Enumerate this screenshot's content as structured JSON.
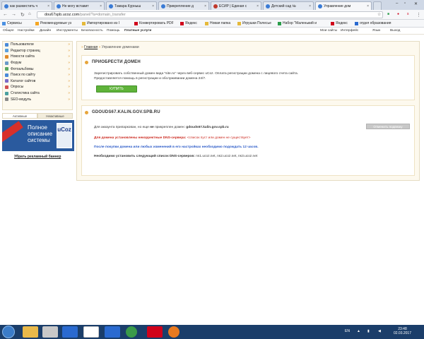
{
  "tabs": [
    {
      "label": "как разместить ч",
      "color": "#3a7bd5"
    },
    {
      "label": "Не могу вставит",
      "color": "#3a7bd5"
    },
    {
      "label": "Тамара Курныш",
      "color": "#3a7bd5"
    },
    {
      "label": "Прикрепление д",
      "color": "#3a7bd5"
    },
    {
      "label": "ЕСИР | Единая с",
      "color": "#c0392b"
    },
    {
      "label": "Детский сад №",
      "color": "#3a7bd5"
    },
    {
      "label": "Управление дом",
      "color": "#3a7bd5"
    }
  ],
  "address": {
    "host": "dou67spb.ucoz.com",
    "path": "/panel/?a=domain_transfer"
  },
  "bookmarks": [
    {
      "label": "Сервисы",
      "color": "#4a90e2"
    },
    {
      "label": "Рекомендуемые уз",
      "color": "#f5a623"
    },
    {
      "label": "Импортировано из I",
      "color": "#e5b93a"
    },
    {
      "label": "Конвертировать PDF",
      "color": "#d0021b"
    },
    {
      "label": "Яндекс",
      "color": "#d0021b"
    },
    {
      "label": "Новая папка",
      "color": "#e5b93a"
    },
    {
      "label": "Игрушки Полесье",
      "color": "#e5b93a"
    },
    {
      "label": "Набор \"Маленький и",
      "color": "#2a9d4a"
    },
    {
      "label": "Яндекс",
      "color": "#d0021b"
    },
    {
      "label": "отдел образования",
      "color": "#2a6ad0"
    }
  ],
  "ucoz_menu": {
    "left": [
      "Общее",
      "Настройки",
      "Дизайн",
      "Инструменты",
      "Безопасность",
      "Помощь",
      "Платные услуги"
    ],
    "right": [
      "Мои сайты",
      "Интерфейс",
      "Язык",
      "Выход"
    ]
  },
  "sidebar": {
    "items": [
      {
        "label": "Пользователи",
        "color": "#4a8ad8"
      },
      {
        "label": "Редактор страниц",
        "color": "#5aa0e0"
      },
      {
        "label": "Новости сайта",
        "color": "#e08a2a"
      },
      {
        "label": "Форум",
        "color": "#6a9ac8"
      },
      {
        "label": "Фотоальбомы",
        "color": "#5aa860"
      },
      {
        "label": "Поиск по сайту",
        "color": "#4a8ad8"
      },
      {
        "label": "Каталог сайтов",
        "color": "#7a6ac8"
      },
      {
        "label": "Опросы",
        "color": "#d05050"
      },
      {
        "label": "Статистика сайта",
        "color": "#4aa0a0"
      },
      {
        "label": "SEO-модуль",
        "color": "#8a8a8a"
      }
    ],
    "tabs": [
      "Активные",
      "Неактивные"
    ]
  },
  "banner": {
    "line1": "Полное",
    "line2": "описание",
    "line3": "системы",
    "logo": "uCoz",
    "remove_label": "Убрать рекламный баннер"
  },
  "breadcrumb": {
    "home": "Главная",
    "current": "Управление доменами"
  },
  "buy_card": {
    "title": "ПРИОБРЕСТИ ДОМЕН",
    "line1": "Зарегистрировать собственный домен вида \"site.ru\" через веб-сервис uCoz. Оплата регистрации домена с лицевого счета сайта.",
    "line2": "Предоставляется помощь в регистрации и обслуживании домена 24/7.",
    "button": "КУПИТЬ"
  },
  "domain_card": {
    "title": "GDOUDS67.KALIN.GOV.SPB.RU",
    "line1_a": "Для аккаунта припаркован, но еще",
    "line1_b": "не",
    "line1_c": "прикреплен домен:",
    "domain": "gdouds67.kalin.gov.spb.ru",
    "unbind_button": "Отменить подвязку",
    "warn_a": "Для домена установлены некорректные DNS-сервера:",
    "warn_b": "<список пуст или домен не существует>",
    "wait": "После покупки домена или любых изменений в его настройках необходимо подождать 12 часов.",
    "dns_a": "Необходимо установить следующий список DNS-серверов:",
    "dns_b": "ns1.ucoz.net, ns2.ucoz.net, ns3.ucoz.net"
  },
  "taskbar": {
    "lang": "EN",
    "time": "23:48",
    "date": "02.03.2017"
  }
}
